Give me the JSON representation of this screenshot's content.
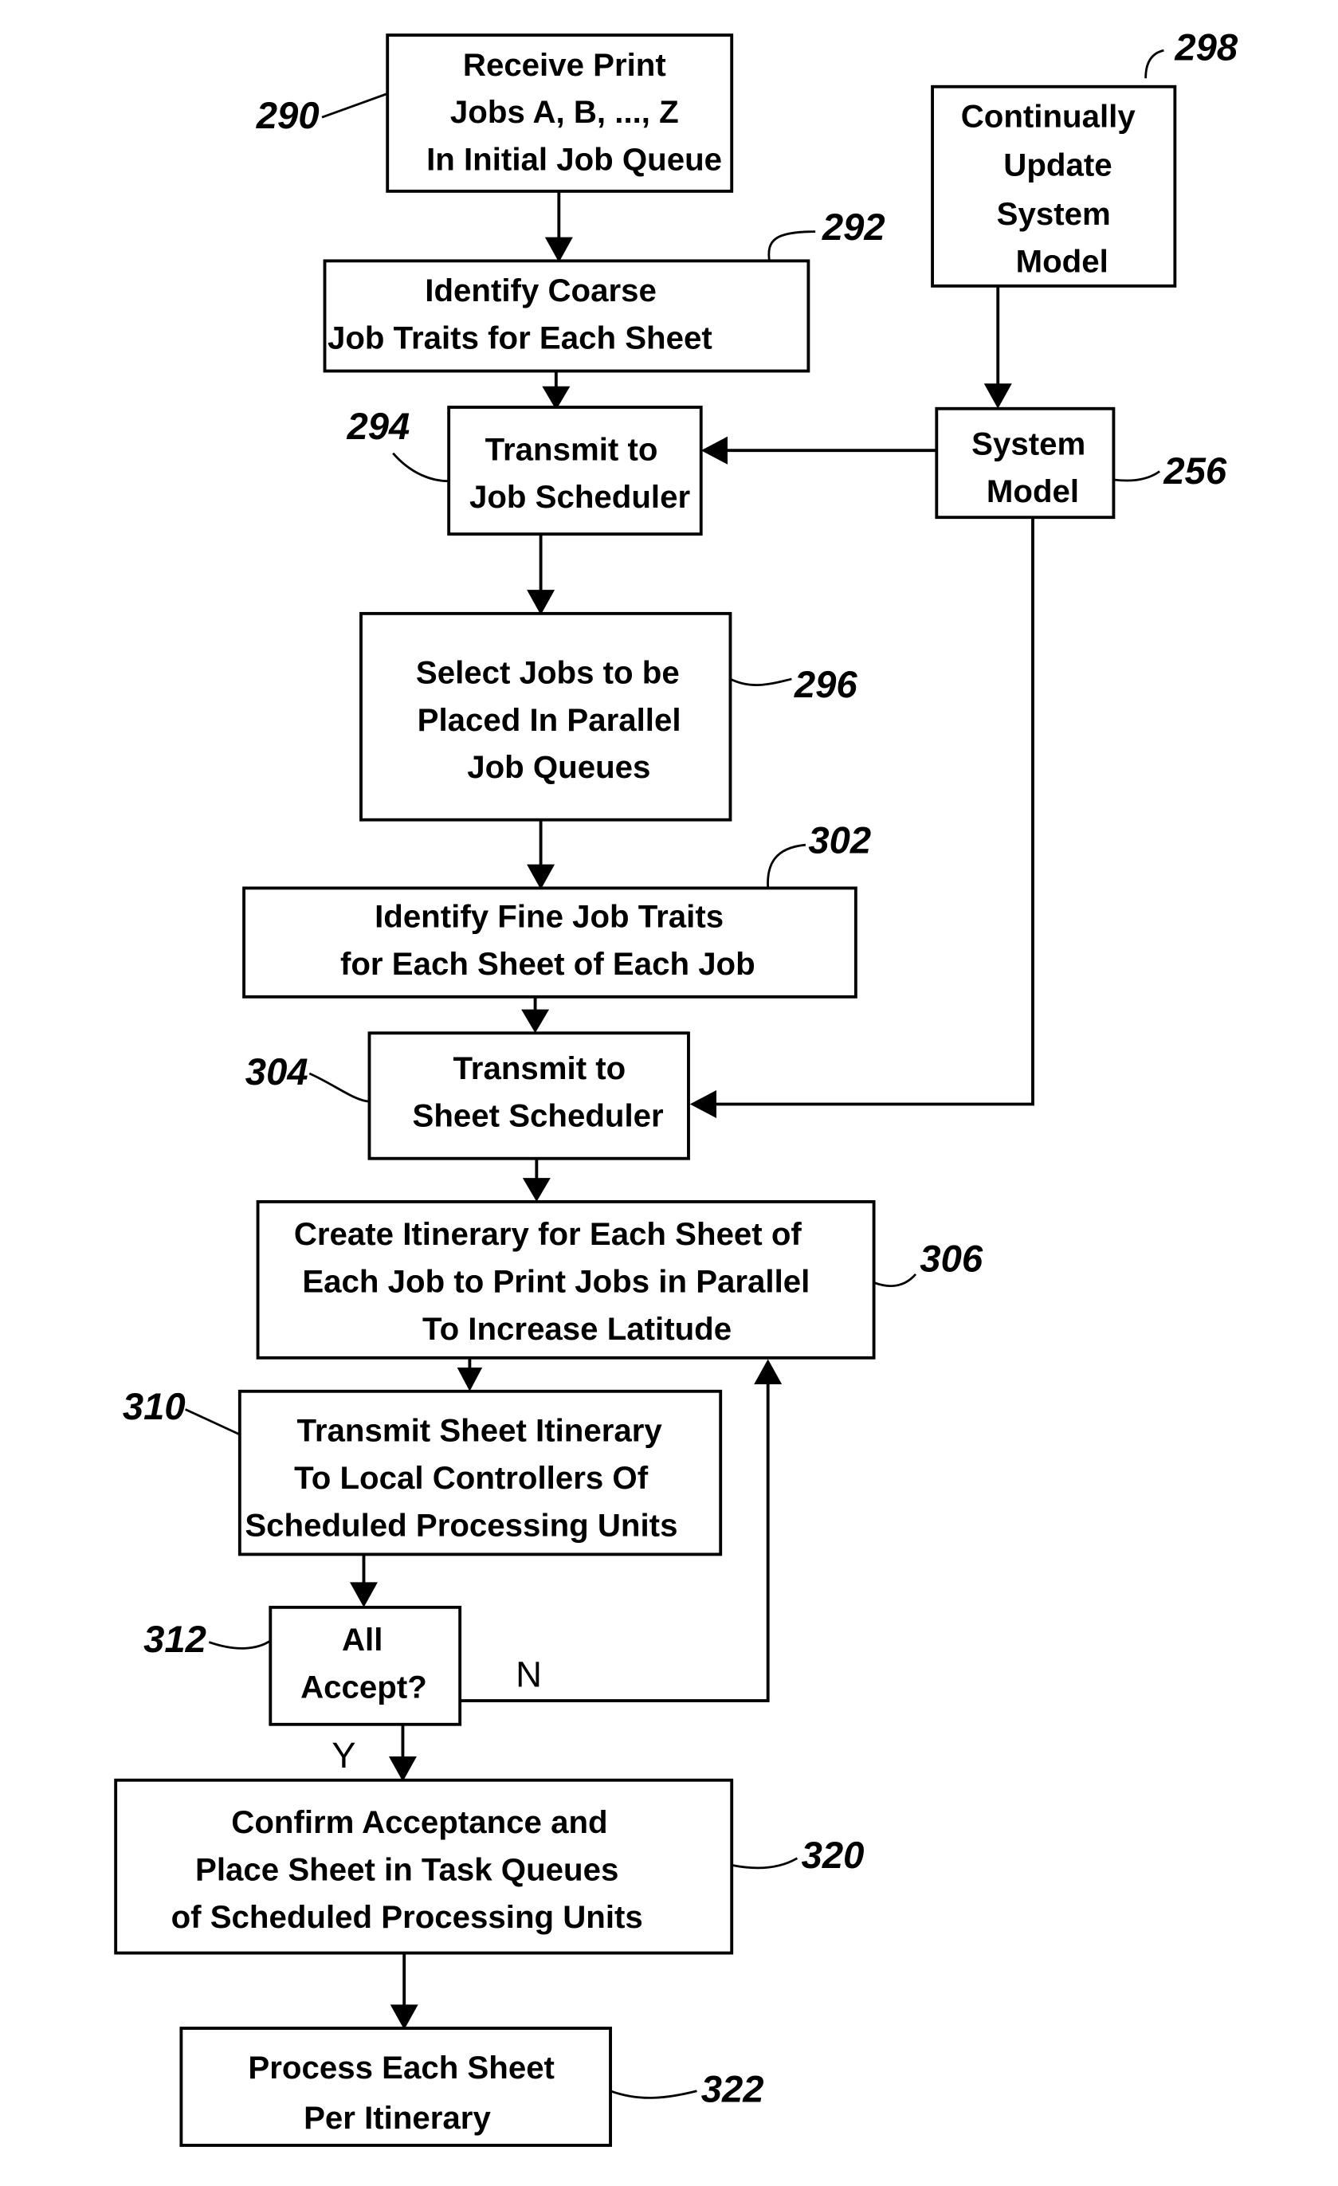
{
  "diagram": {
    "nodes": [
      {
        "id": "290",
        "lines": [
          "Receive Print",
          "Jobs A, B, ..., Z",
          "In Initial Job Queue"
        ]
      },
      {
        "id": "292",
        "lines": [
          "Identify Coarse",
          "Job Traits for Each Sheet"
        ]
      },
      {
        "id": "294",
        "lines": [
          "Transmit to",
          "Job Scheduler"
        ]
      },
      {
        "id": "296",
        "lines": [
          "Select Jobs to be",
          "Placed In Parallel",
          "Job Queues"
        ]
      },
      {
        "id": "302",
        "lines": [
          "Identify Fine Job Traits",
          "for Each Sheet of Each Job"
        ]
      },
      {
        "id": "304",
        "lines": [
          "Transmit to",
          "Sheet Scheduler"
        ]
      },
      {
        "id": "306",
        "lines": [
          "Create Itinerary for Each Sheet of",
          "Each Job to Print Jobs in Parallel",
          "To Increase Latitude"
        ]
      },
      {
        "id": "310",
        "lines": [
          "Transmit Sheet Itinerary",
          "To Local Controllers Of",
          "Scheduled Processing Units"
        ]
      },
      {
        "id": "312",
        "lines": [
          "All",
          "Accept?"
        ]
      },
      {
        "id": "320",
        "lines": [
          "Confirm Acceptance and",
          "Place Sheet in Task Queues",
          "of  Scheduled Processing Units"
        ]
      },
      {
        "id": "322",
        "lines": [
          "Process Each Sheet",
          "Per Itinerary"
        ]
      },
      {
        "id": "298",
        "lines": [
          "Continually",
          "Update",
          "System",
          "Model"
        ]
      },
      {
        "id": "256",
        "lines": [
          "System",
          "Model"
        ]
      }
    ],
    "branch_labels": {
      "no": "N",
      "yes": "Y"
    },
    "edges": [
      [
        "290",
        "292"
      ],
      [
        "292",
        "294"
      ],
      [
        "294",
        "296"
      ],
      [
        "296",
        "302"
      ],
      [
        "302",
        "304"
      ],
      [
        "304",
        "306"
      ],
      [
        "306",
        "310"
      ],
      [
        "310",
        "312"
      ],
      [
        "312",
        "320",
        "Y"
      ],
      [
        "312",
        "306",
        "N"
      ],
      [
        "320",
        "322"
      ],
      [
        "298",
        "256"
      ],
      [
        "256",
        "294"
      ],
      [
        "256",
        "304"
      ]
    ]
  }
}
